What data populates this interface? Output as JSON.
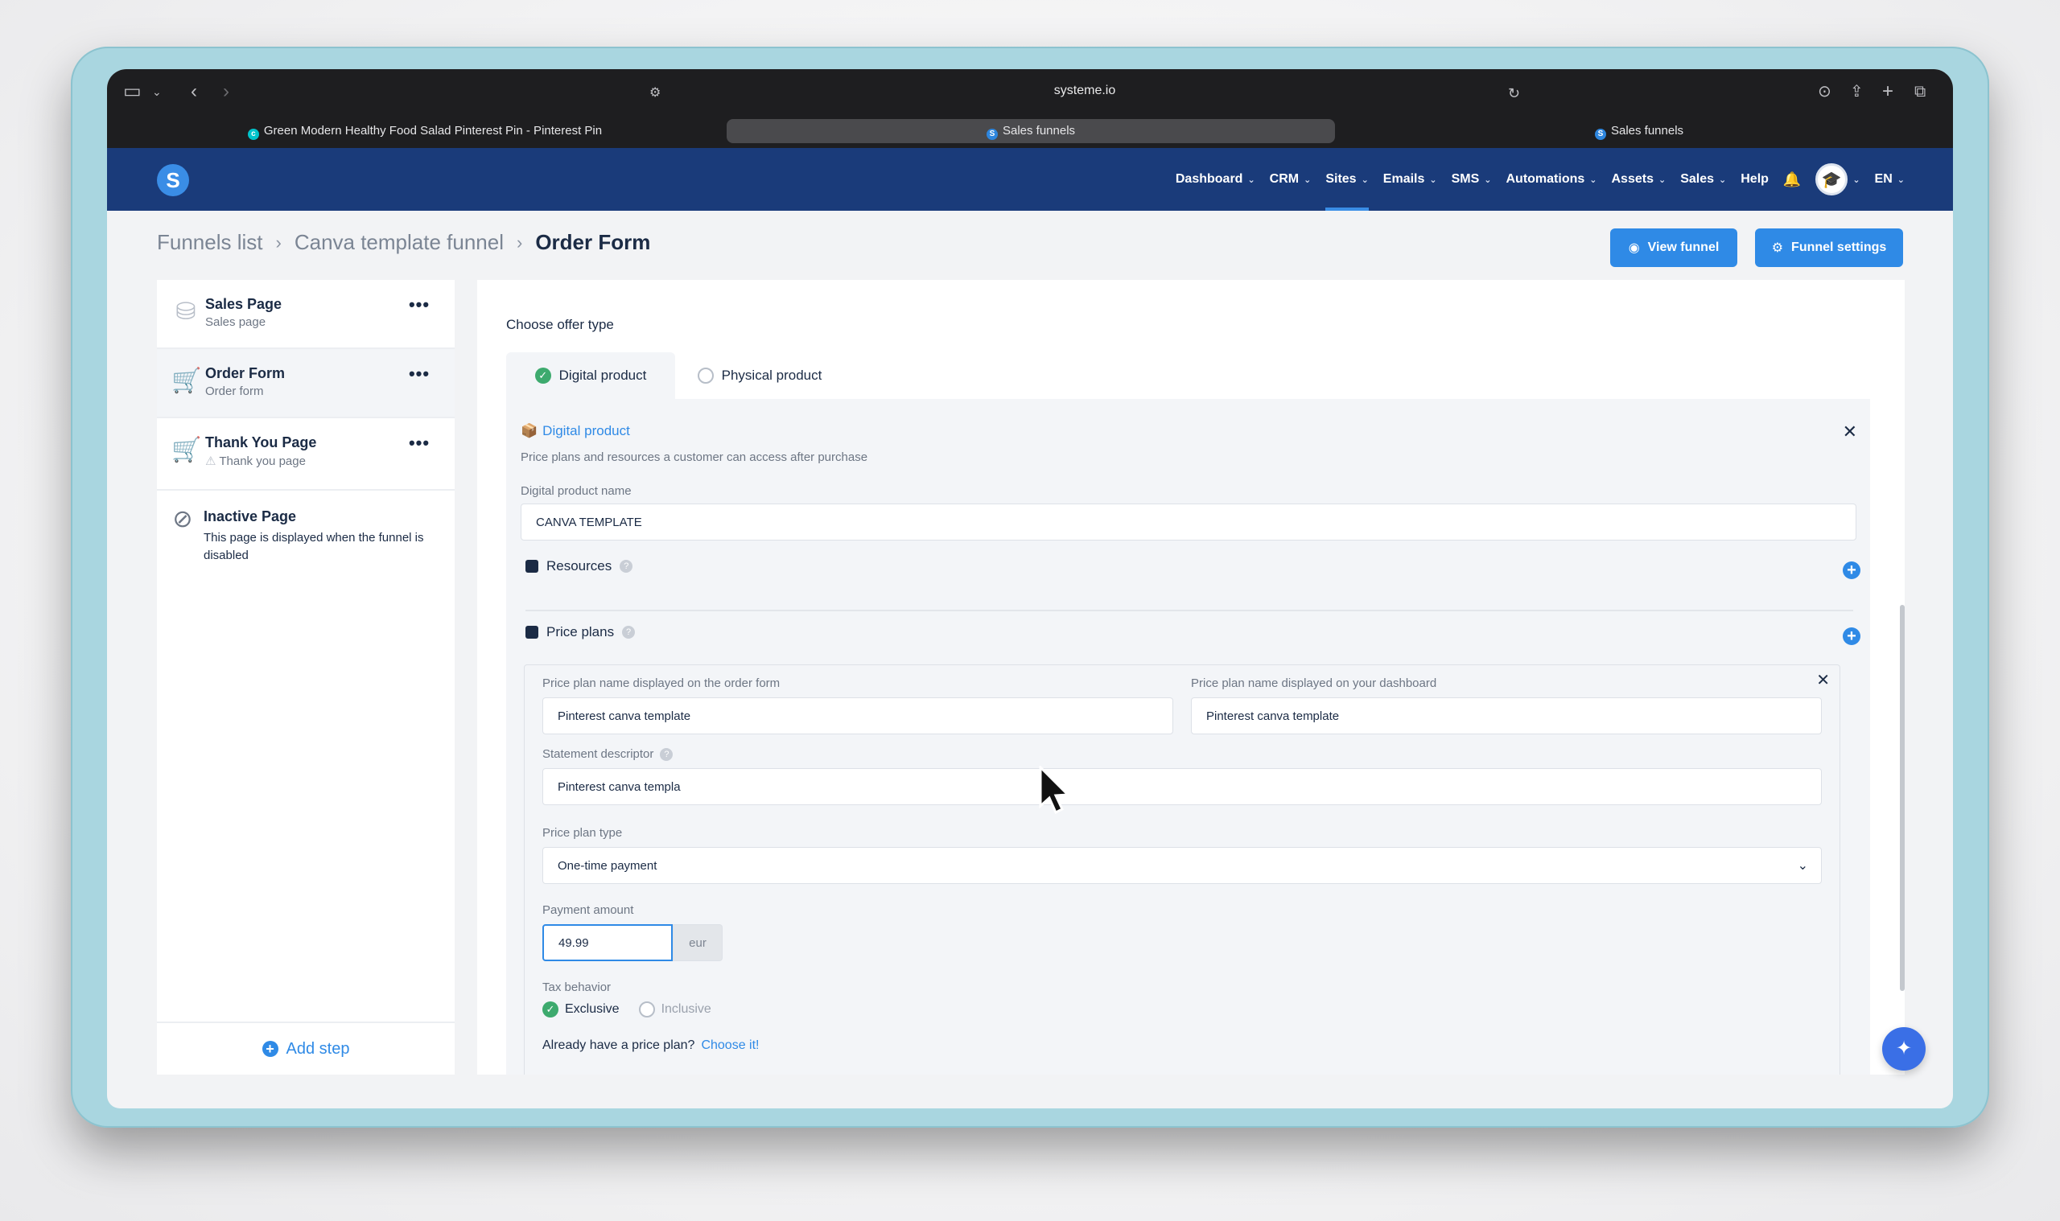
{
  "browser": {
    "url": "systeme.io",
    "tabs": [
      {
        "label": "Green Modern Healthy Food Salad Pinterest Pin - Pinterest Pin",
        "favicon": "canva-icon",
        "active": false
      },
      {
        "label": "Sales funnels",
        "favicon": "systeme-icon",
        "active": true
      },
      {
        "label": "Sales funnels",
        "favicon": "systeme-icon",
        "active": false
      }
    ]
  },
  "nav": {
    "logo": "S",
    "items": [
      {
        "label": "Dashboard",
        "dropdown": true
      },
      {
        "label": "CRM",
        "dropdown": true
      },
      {
        "label": "Sites",
        "dropdown": true,
        "active": true
      },
      {
        "label": "Emails",
        "dropdown": true
      },
      {
        "label": "SMS",
        "dropdown": true
      },
      {
        "label": "Automations",
        "dropdown": true
      },
      {
        "label": "Assets",
        "dropdown": true
      },
      {
        "label": "Sales",
        "dropdown": true
      },
      {
        "label": "Help",
        "dropdown": false
      }
    ],
    "language": "EN"
  },
  "breadcrumb": {
    "level1": "Funnels list",
    "level2": "Canva template funnel",
    "current": "Order Form"
  },
  "actions": {
    "view_funnel": "View funnel",
    "funnel_settings": "Funnel settings"
  },
  "steps": {
    "items": [
      {
        "title": "Sales Page",
        "subtitle": "Sales page"
      },
      {
        "title": "Order Form",
        "subtitle": "Order form"
      },
      {
        "title": "Thank You Page",
        "subtitle": "Thank you page"
      }
    ],
    "inactive": {
      "title": "Inactive Page",
      "description": "This page is displayed when the funnel is disabled"
    },
    "add_step": "Add step"
  },
  "offer": {
    "choose_label": "Choose offer type",
    "tabs": [
      "Digital product",
      "Physical product"
    ],
    "digital": {
      "title": "Digital product",
      "description": "Price plans and resources a customer can access after purchase",
      "name_label": "Digital product name",
      "name_value": "CANVA TEMPLATE",
      "resources_label": "Resources",
      "price_plans_label": "Price plans"
    },
    "plan": {
      "order_form_name_label": "Price plan name displayed on the order form",
      "order_form_name_value": "Pinterest canva template",
      "dashboard_name_label": "Price plan name displayed on your dashboard",
      "dashboard_name_value": "Pinterest canva template",
      "descriptor_label": "Statement descriptor",
      "descriptor_value": "Pinterest canva templa",
      "type_label": "Price plan type",
      "type_value": "One-time payment",
      "amount_label": "Payment amount",
      "amount_value": "49.99",
      "currency": "eur",
      "tax_label": "Tax behavior",
      "tax_options": [
        "Exclusive",
        "Inclusive"
      ],
      "tax_selected": "Exclusive",
      "existing_prompt": "Already have a price plan?",
      "existing_link": "Choose it!"
    }
  }
}
